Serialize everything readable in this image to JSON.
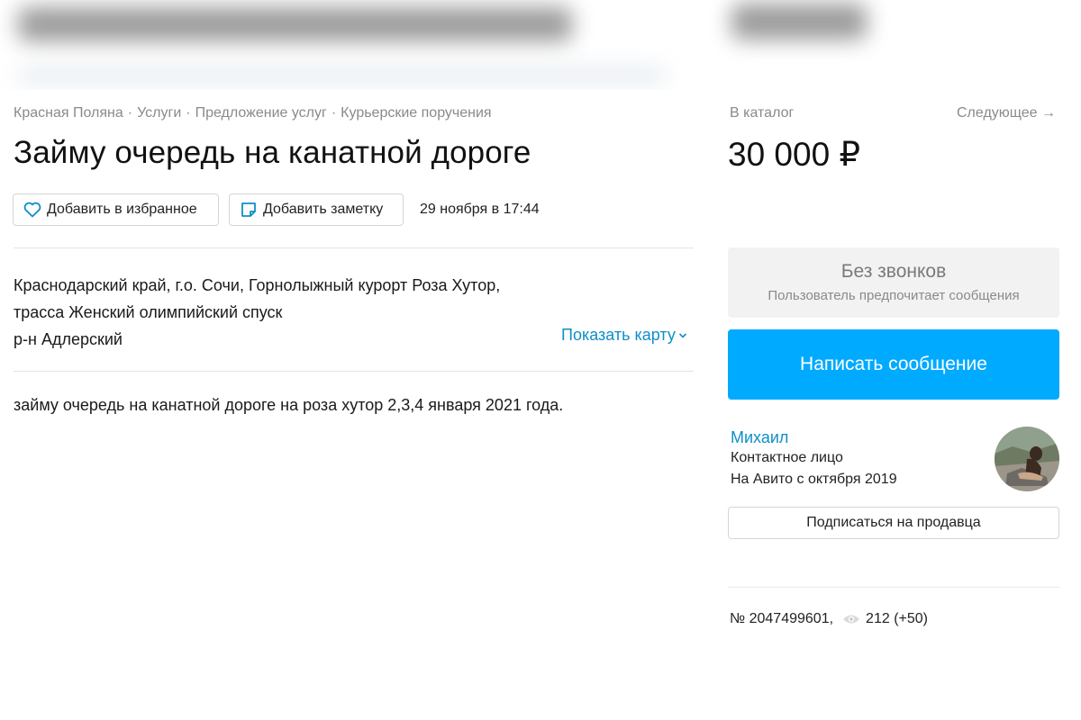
{
  "breadcrumb": [
    "Красная Поляна",
    "Услуги",
    "Предложение услуг",
    "Курьерские поручения"
  ],
  "breadcrumb_separator": "·",
  "title": "Займу очередь на канатной дороге",
  "actions": {
    "favorite_label": "Добавить в избранное",
    "note_label": "Добавить заметку",
    "date": "29 ноября в 17:44"
  },
  "address": {
    "line1": "Краснодарский край, г.о. Сочи, Горнолыжный курорт Роза Хутор,",
    "line2": "трасса Женский олимпийский спуск",
    "line3": "р-н Адлерский",
    "map_link": "Показать карту"
  },
  "description": "займу очередь на канатной дороге на роза хутор 2,3,4 января 2021 года.",
  "sidebar": {
    "catalog_link": "В каталог",
    "next_link": "Следующее →",
    "price": "30 000 ₽",
    "no_calls_title": "Без звонков",
    "no_calls_subtitle": "Пользователь предпочитает сообщения",
    "message_button": "Написать сообщение",
    "seller_name": "Михаил",
    "seller_role": "Контактное лицо",
    "seller_since": "На Авито с октября 2019",
    "subscribe_button": "Подписаться на продавца",
    "ad_number": "№ 2047499601,",
    "views": "212 (+50)"
  },
  "colors": {
    "link": "#0f8fc7",
    "primary_button": "#00aaff",
    "muted_text": "#8a8a8a"
  },
  "icons": [
    "heart-icon",
    "note-icon",
    "chevron-down-icon",
    "eye-icon"
  ]
}
